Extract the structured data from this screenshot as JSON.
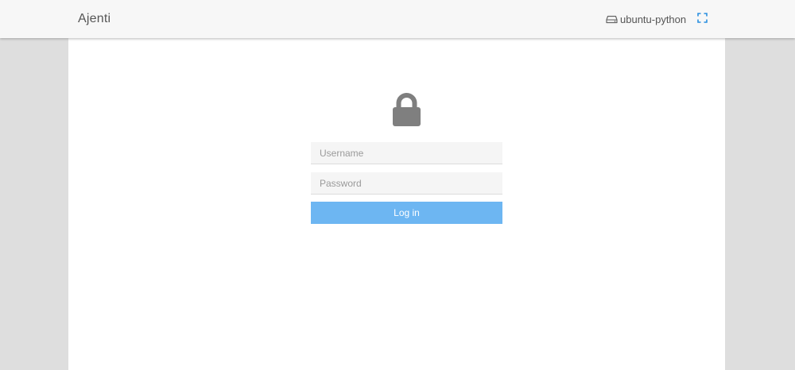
{
  "header": {
    "brand": "Ajenti",
    "host_name": "ubuntu-python",
    "host_icon": "server-drive-icon",
    "fullscreen_icon": "expand-icon",
    "accent_color": "#2a8fe0"
  },
  "login": {
    "lock_icon": "lock-icon",
    "username_placeholder": "Username",
    "username_value": "",
    "password_placeholder": "Password",
    "password_value": "",
    "submit_label": "Log in",
    "submit_color": "#6db6f2"
  }
}
